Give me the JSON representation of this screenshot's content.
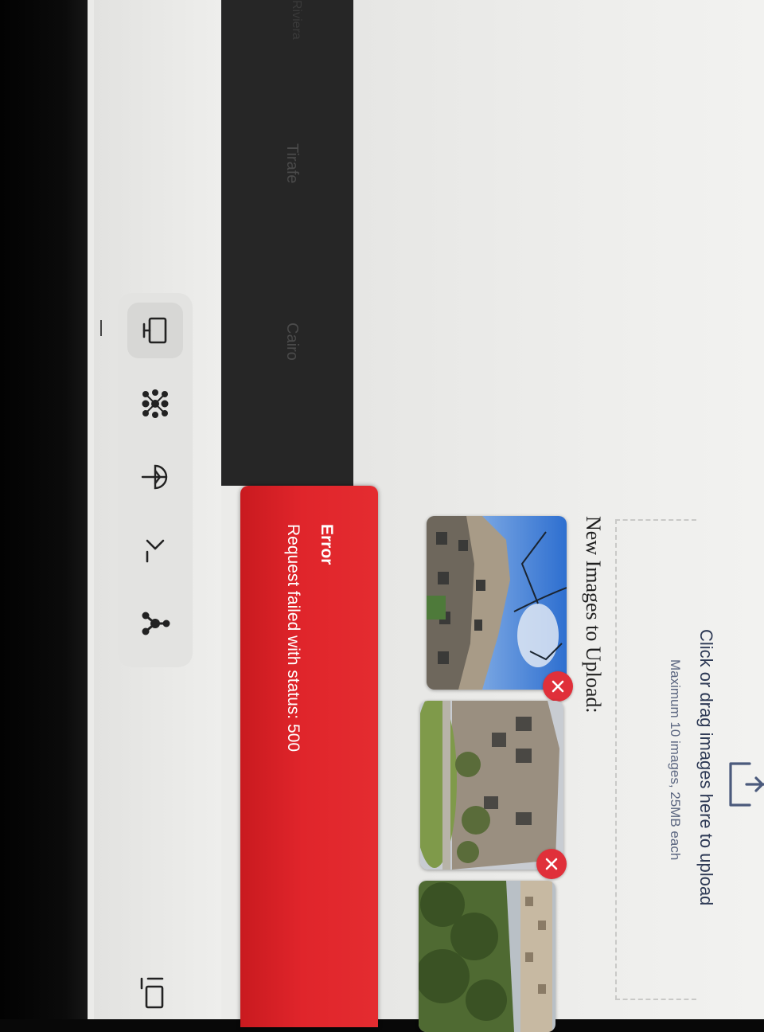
{
  "sidebar_panel": {
    "items": [
      "Riviera",
      "Tirafe",
      "Cairo"
    ]
  },
  "toolbar": {
    "icons": [
      "monitor-icon",
      "molecule-grid-icon",
      "tree-icon",
      "terminal-icon",
      "graph-icon"
    ],
    "active": "monitor-icon"
  },
  "upload": {
    "title": "Click or drag images here to upload",
    "subtitle": "Maximum 10 images, 25MB each"
  },
  "new_images": {
    "heading": "New Images to Upload:",
    "count_visible": 3
  },
  "toast": {
    "title": "Error",
    "message": "Request failed with status: 500",
    "color": "#e0252b"
  },
  "colors": {
    "remove": "#e0303a",
    "dark_panel": "#262626"
  }
}
